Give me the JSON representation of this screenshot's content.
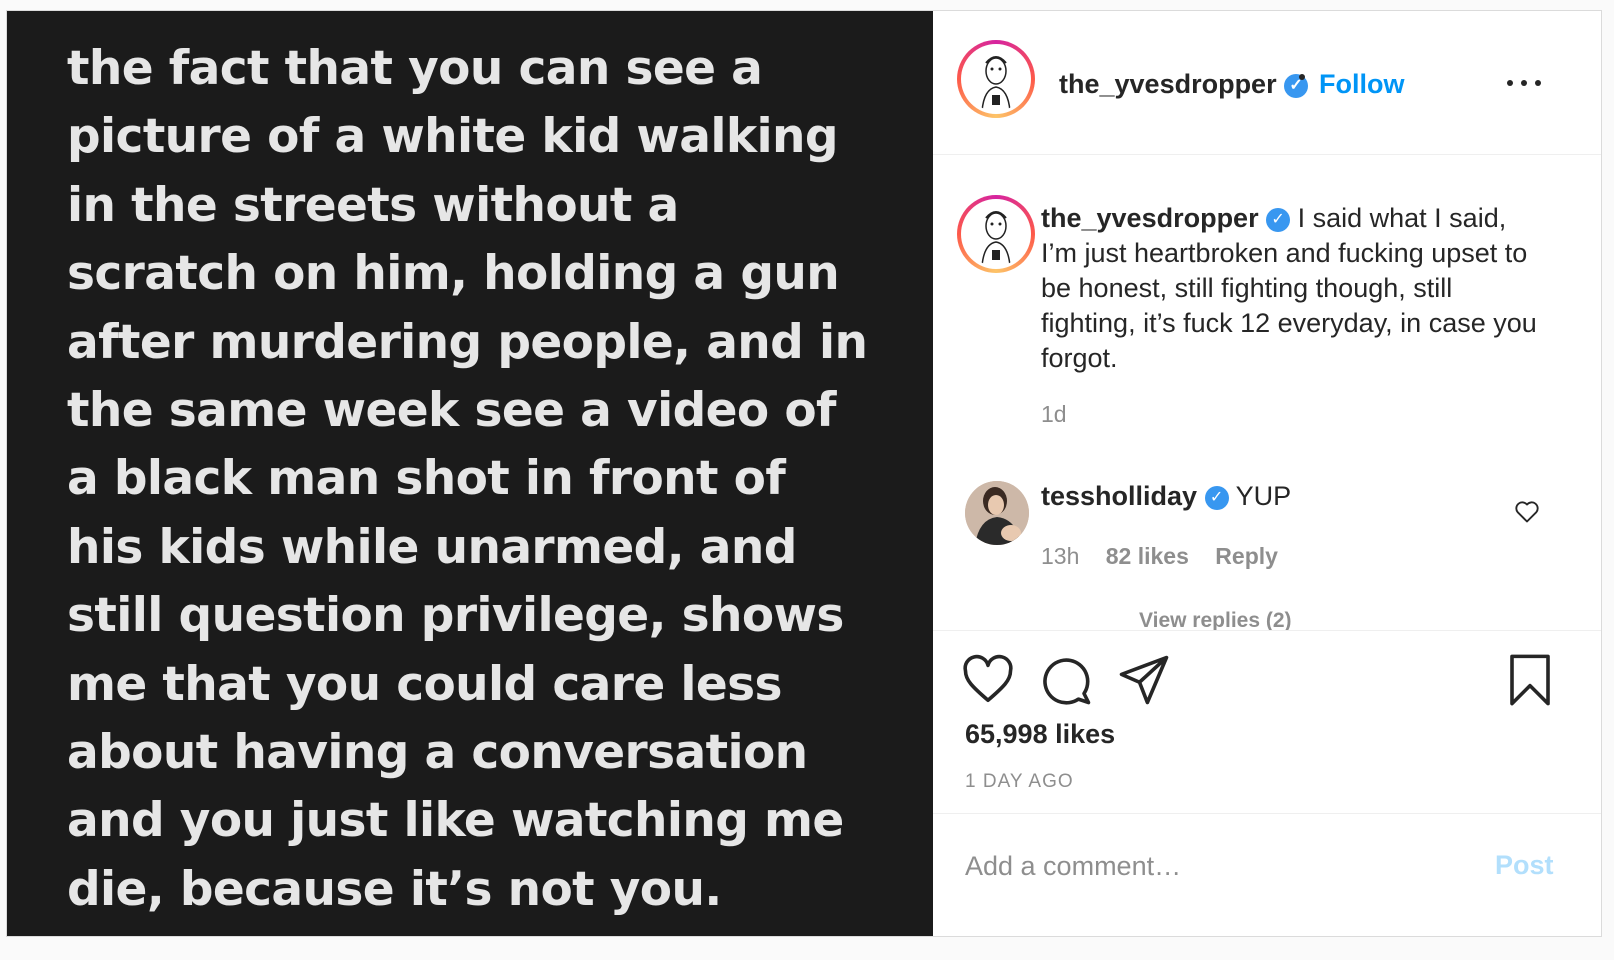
{
  "media": {
    "lines": [
      "the fact that you can see a",
      "picture of a white kid walking",
      "in the streets without a",
      "scratch on him, holding a gun",
      "after murdering people, and in",
      "the same week see a video of",
      "a black man shot in front of",
      "his kids while unarmed, and",
      "still question privilege, shows",
      "me that you could care less",
      "about having a conversation",
      "and you just like watching me",
      "die, because it’s not you."
    ]
  },
  "header": {
    "username": "the_yvesdropper",
    "verified_glyph": "✓",
    "follow_label": "Follow",
    "more_icon": "more-options-icon"
  },
  "caption": {
    "username": "the_yvesdropper",
    "verified_glyph": "✓",
    "text": " I said what I said, I’m just heartbroken and fucking upset to be honest, still fighting though, still fighting, it’s fuck 12 everyday, in case you forgot.",
    "time": "1d"
  },
  "comment": {
    "username": "tessholliday",
    "verified_glyph": "✓",
    "text": "YUP",
    "time": "13h",
    "likes": "82 likes",
    "reply_label": "Reply",
    "view_replies": "View replies (2)"
  },
  "actions": {
    "likes": "65,998 likes",
    "time_ago": "1 DAY AGO"
  },
  "comment_box": {
    "placeholder": "Add a comment…",
    "post_label": "Post"
  },
  "colors": {
    "accent": "#0095f6",
    "verified": "#3897f0",
    "muted": "#8e8e8e",
    "media_bg": "#1b1b1b"
  }
}
